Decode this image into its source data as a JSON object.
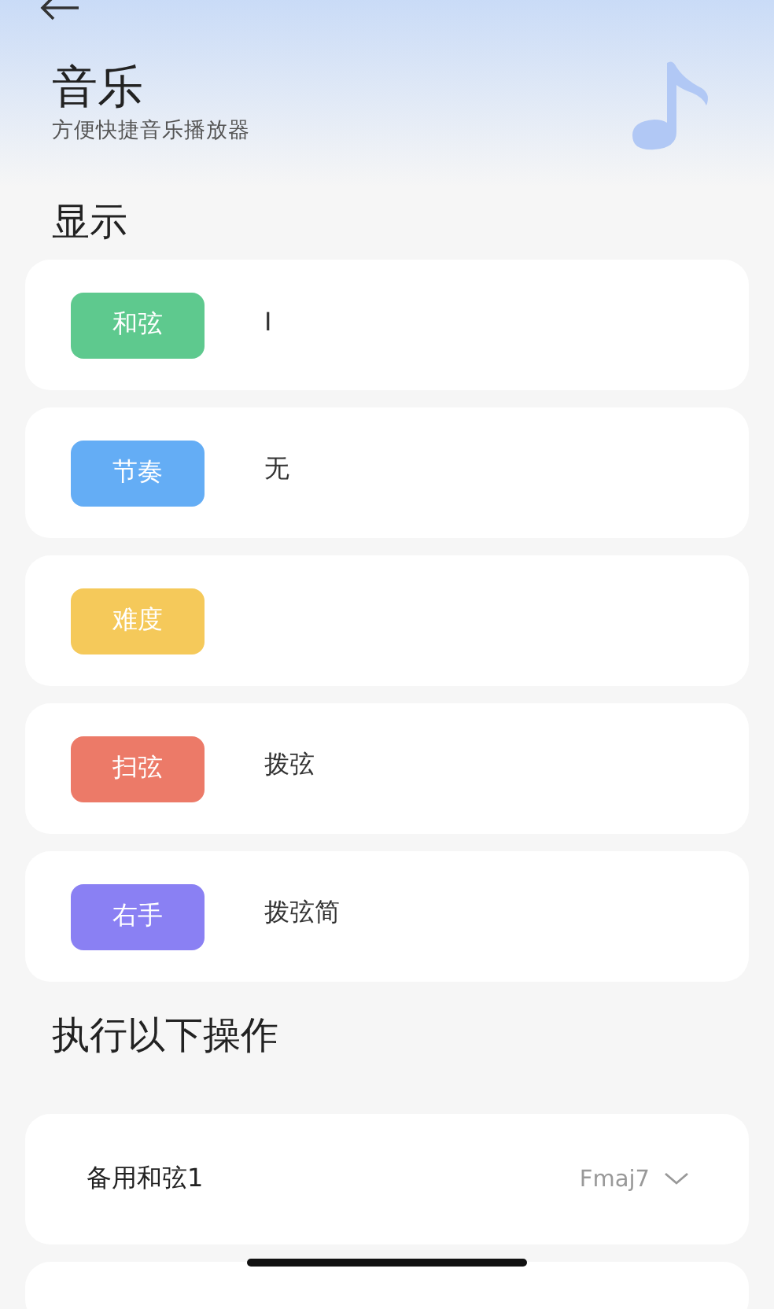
{
  "header": {
    "title": "音乐",
    "subtitle": "方便快捷音乐播放器"
  },
  "display_section": {
    "title": "显示",
    "rows": [
      {
        "tag": "和弦",
        "color": "#5ec98e",
        "value": "I"
      },
      {
        "tag": "节奏",
        "color": "#64adf5",
        "value": "无"
      },
      {
        "tag": "难度",
        "color": "#f5c95a"
      },
      {
        "tag": "扫弦",
        "color": "#ec7a68",
        "value": "拨弦"
      },
      {
        "tag": "右手",
        "color": "#8a80f3",
        "value": "拨弦简"
      }
    ]
  },
  "actions_section": {
    "title": "执行以下操作",
    "rows": [
      {
        "label": "备用和弦1",
        "value": "Fmaj7"
      }
    ]
  }
}
